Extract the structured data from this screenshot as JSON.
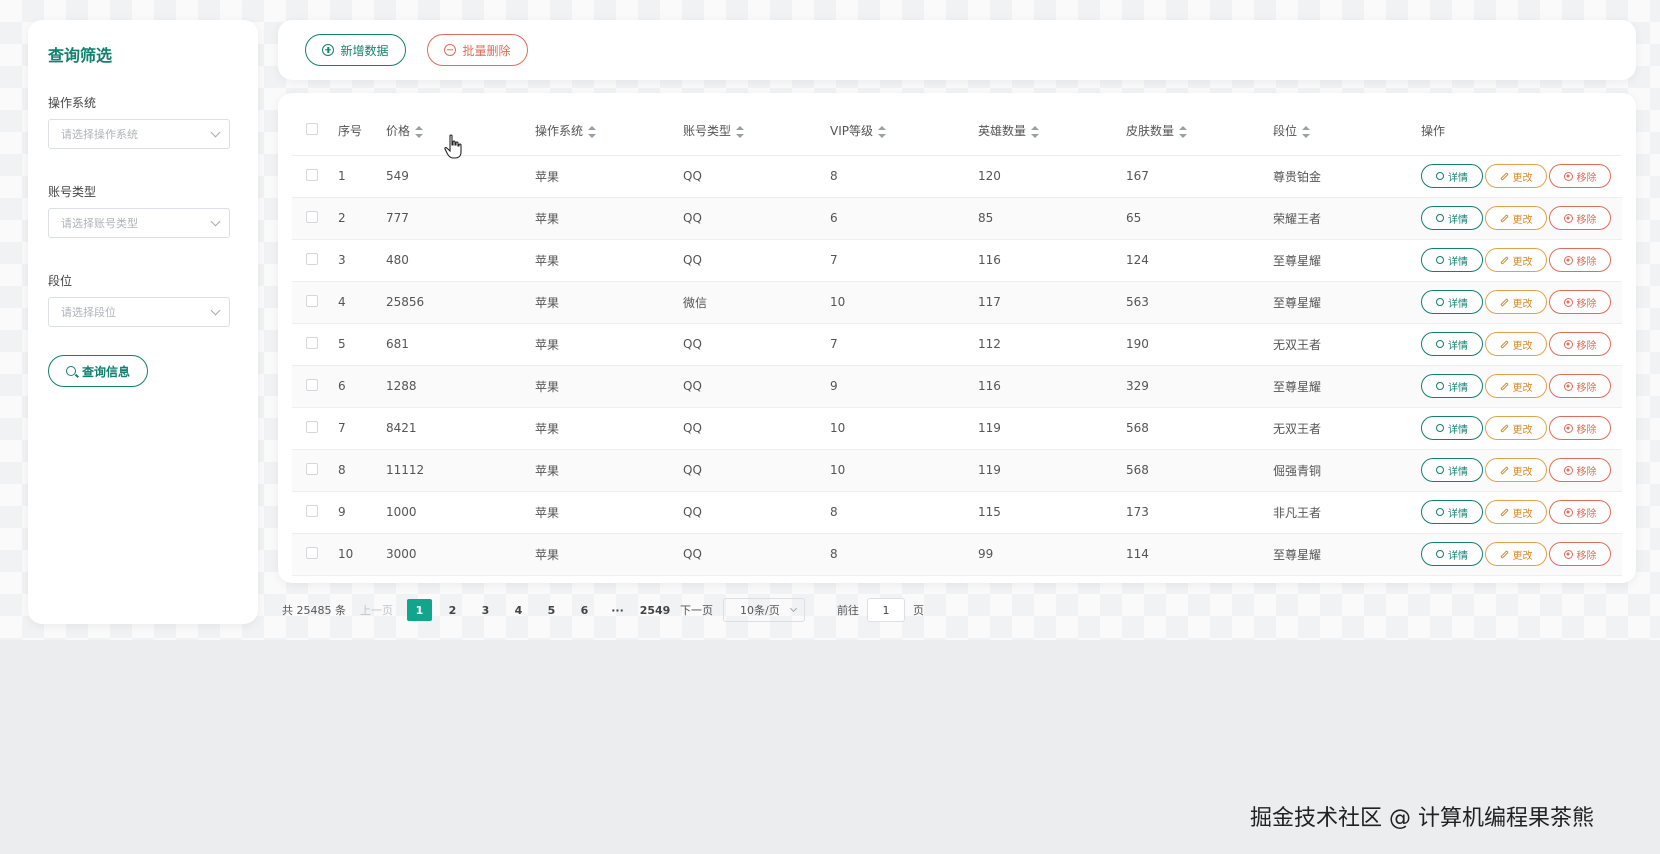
{
  "sidebar": {
    "title": "查询筛选",
    "filters": [
      {
        "label": "操作系统",
        "placeholder": "请选择操作系统"
      },
      {
        "label": "账号类型",
        "placeholder": "请选择账号类型"
      },
      {
        "label": "段位",
        "placeholder": "请选择段位"
      }
    ],
    "query_button": "查询信息"
  },
  "toolbar": {
    "add_label": "新增数据",
    "batch_delete_label": "批量删除"
  },
  "table": {
    "headers": [
      "序号",
      "价格",
      "操作系统",
      "账号类型",
      "VIP等级",
      "英雄数量",
      "皮肤数量",
      "段位",
      "操作"
    ],
    "rows": [
      {
        "no": "1",
        "price": "549",
        "os": "苹果",
        "account": "QQ",
        "vip": "8",
        "heroes": "120",
        "skins": "167",
        "rank": "尊贵铂金"
      },
      {
        "no": "2",
        "price": "777",
        "os": "苹果",
        "account": "QQ",
        "vip": "6",
        "heroes": "85",
        "skins": "65",
        "rank": "荣耀王者"
      },
      {
        "no": "3",
        "price": "480",
        "os": "苹果",
        "account": "QQ",
        "vip": "7",
        "heroes": "116",
        "skins": "124",
        "rank": "至尊星耀"
      },
      {
        "no": "4",
        "price": "25856",
        "os": "苹果",
        "account": "微信",
        "vip": "10",
        "heroes": "117",
        "skins": "563",
        "rank": "至尊星耀"
      },
      {
        "no": "5",
        "price": "681",
        "os": "苹果",
        "account": "QQ",
        "vip": "7",
        "heroes": "112",
        "skins": "190",
        "rank": "无双王者"
      },
      {
        "no": "6",
        "price": "1288",
        "os": "苹果",
        "account": "QQ",
        "vip": "9",
        "heroes": "116",
        "skins": "329",
        "rank": "至尊星耀"
      },
      {
        "no": "7",
        "price": "8421",
        "os": "苹果",
        "account": "QQ",
        "vip": "10",
        "heroes": "119",
        "skins": "568",
        "rank": "无双王者"
      },
      {
        "no": "8",
        "price": "11112",
        "os": "苹果",
        "account": "QQ",
        "vip": "10",
        "heroes": "119",
        "skins": "568",
        "rank": "倔强青铜"
      },
      {
        "no": "9",
        "price": "1000",
        "os": "苹果",
        "account": "QQ",
        "vip": "8",
        "heroes": "115",
        "skins": "173",
        "rank": "非凡王者"
      },
      {
        "no": "10",
        "price": "3000",
        "os": "苹果",
        "account": "QQ",
        "vip": "8",
        "heroes": "99",
        "skins": "114",
        "rank": "至尊星耀"
      }
    ],
    "actions": {
      "detail": "详情",
      "edit": "更改",
      "remove": "移除"
    }
  },
  "pagination": {
    "total": "共 25485 条",
    "prev": "上一页",
    "pages": [
      "1",
      "2",
      "3",
      "4",
      "5",
      "6",
      "···",
      "2549"
    ],
    "active_page": "1",
    "next": "下一页",
    "page_size": "10条/页",
    "goto_prefix": "前往",
    "goto_value": "1",
    "goto_suffix": "页"
  },
  "watermark": "掘金技术社区 @ 计算机编程果茶熊",
  "colors": {
    "primary": "#11806f",
    "danger": "#e06c5a",
    "warning": "#d68a2a",
    "active_page": "#11a58c"
  }
}
